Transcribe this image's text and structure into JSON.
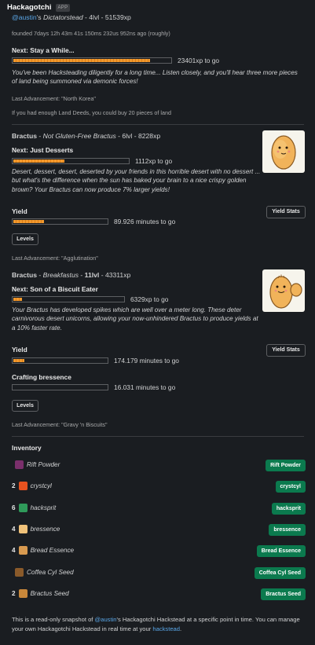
{
  "header": {
    "app_name": "Hackagotchi",
    "badge": "APP"
  },
  "stead": {
    "owner": "@austin",
    "owner_suffix": "'s",
    "name": "Dictatorstead",
    "level": "4lvl",
    "xp": "51539xp",
    "founded": "founded 7days 12h 43m 41s 150ms 232us 952ns ago (roughly)",
    "next_label": "Next: Stay a While...",
    "progress": 0.87,
    "xp_to_go": "23401xp to go",
    "description": "You've been Hacksteading diligently for a long time... Listen closely, and you'll hear three more pieces of land being summoned via demonic forces!",
    "last_advancement": "Last Advancement: \"North Korea\"",
    "land_note": "If you had enough Land Deeds, you could buy 20 pieces of land"
  },
  "plants": [
    {
      "species": "Bractus",
      "name": "Not Gluten-Free Bractus",
      "level": "6lvl",
      "xp": "8228xp",
      "next_label": "Next: Just Desserts",
      "progress": 0.45,
      "xp_to_go": "1112xp to go",
      "description": "Desert, dessert, desert, deserted by your friends in this horrible desert with no dessert ... but what's the difference when the sun has baked your brain to a nice crispy golden brown? Your Bractus can now produce 7% larger yields!",
      "yield_label": "Yield",
      "yield_progress": 0.34,
      "yield_text": "89.926 minutes to go",
      "yield_stats_label": "Yield Stats",
      "levels_label": "Levels",
      "last_advancement": "Last Advancement: \"Agglutination\""
    },
    {
      "species": "Bractus",
      "name": "Breakfastus",
      "level": "11lvl",
      "xp": "43311xp",
      "next_label": "Next: Son of a Biscuit Eater",
      "progress": 0.09,
      "xp_to_go": "6329xp to go",
      "description": "Your Bractus has developed spikes which are well over a meter long. These deter carnivorous desert unicorns, allowing your now-unhindered Bractus to produce yields at a 10% faster rate.",
      "yield_label": "Yield",
      "yield_progress": 0.13,
      "yield_text": "174.179 minutes to go",
      "crafting_label": "Crafting bressence",
      "crafting_progress": 0.02,
      "crafting_text": "16.031 minutes to go",
      "yield_stats_label": "Yield Stats",
      "levels_label": "Levels",
      "last_advancement": "Last Advancement: \"Gravy 'n Biscuits\""
    }
  ],
  "inventory": {
    "title": "Inventory",
    "items": [
      {
        "qty": "",
        "name": "Rift Powder",
        "button": "Rift Powder",
        "icon": "rift-powder-icon",
        "color": "#7a2f6b"
      },
      {
        "qty": "2",
        "name": "crystcyl",
        "button": "crystcyl",
        "icon": "crystcyl-icon",
        "color": "#e8521f"
      },
      {
        "qty": "6",
        "name": "hacksprit",
        "button": "hacksprit",
        "icon": "hacksprit-icon",
        "color": "#2f9a5a"
      },
      {
        "qty": "4",
        "name": "bressence",
        "button": "bressence",
        "icon": "bressence-icon",
        "color": "#f0c27a"
      },
      {
        "qty": "4",
        "name": "Bread Essence",
        "button": "Bread Essence",
        "icon": "bread-essence-icon",
        "color": "#d89a50"
      },
      {
        "qty": "",
        "name": "Coffea Cyl Seed",
        "button": "Coffea Cyl Seed",
        "icon": "coffea-seed-icon",
        "color": "#8a5a2a"
      },
      {
        "qty": "2",
        "name": "Bractus Seed",
        "button": "Bractus Seed",
        "icon": "bractus-seed-icon",
        "color": "#c8873a"
      }
    ]
  },
  "footer": {
    "text_before": "This is a read-only snapshot of ",
    "owner": "@austin",
    "text_middle": "'s Hackagotchi Hackstead at a specific point in time. You can manage your own Hackagotchi Hackstead in real time at your ",
    "link": "hackstead",
    "text_after": "."
  },
  "colors": {
    "background": "#1a1d21",
    "bar_fill": "#f29a2e",
    "button_green": "#0b7a4e",
    "mention": "#5aa7e8"
  }
}
